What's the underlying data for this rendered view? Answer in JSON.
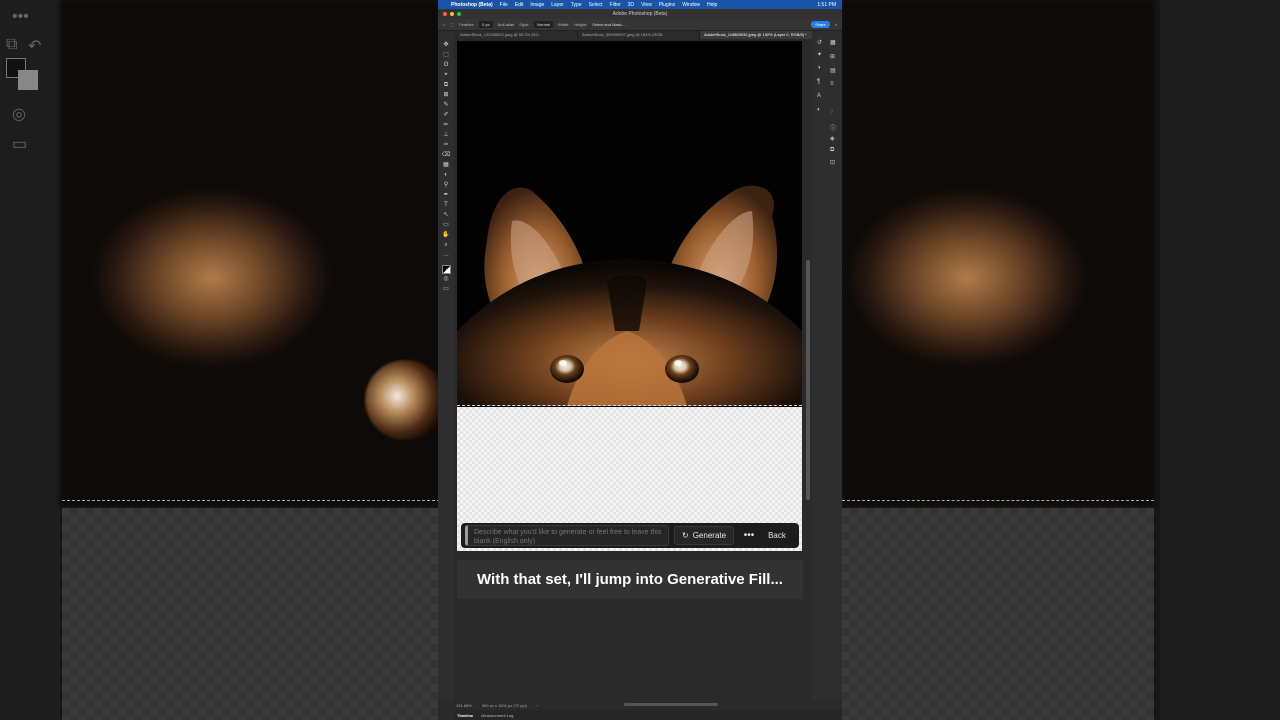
{
  "menubar": {
    "app_name": "Photoshop (Beta)",
    "items": [
      "File",
      "Edit",
      "Image",
      "Layer",
      "Type",
      "Select",
      "Filter",
      "3D",
      "View",
      "Plugins",
      "Window",
      "Help"
    ],
    "clock": "1:51 PM"
  },
  "window": {
    "title": "Adobe Photoshop (Beta)"
  },
  "options_bar": {
    "feather_label": "Feather:",
    "feather_value": "0 px",
    "anti_alias_label": "Anti-alias",
    "style_label": "Style:",
    "style_value": "Normal",
    "width_label": "Width:",
    "height_label": "Height:",
    "select_mask_label": "Select and Mask...",
    "share_label": "Share"
  },
  "document_tabs": [
    {
      "label": "AdobeStock_122035922.jpeg @ 55.2% (RG..."
    },
    {
      "label": "AdobeStock_599559497.jpeg @ 184% (RGB..."
    },
    {
      "label": "AdobeStock_116869932.jpeg @ 192% (Layer 0, RGB/8) *"
    }
  ],
  "tools": [
    "✥",
    "⬚",
    "ʘ",
    "⌖",
    "⧉",
    "⊠",
    "✎",
    "✐",
    "✏",
    "⊥",
    "✑",
    "⌫",
    "▦",
    "◐",
    "⚲",
    "✒",
    "T",
    "↖",
    "▭",
    "✋",
    "⌕",
    "…"
  ],
  "task_bar": {
    "prompt_placeholder": "Describe what you'd like to generate or feel free to leave this blank (English only).",
    "generate_label": "Generate",
    "more_label": "•••",
    "back_label": "Back"
  },
  "caption": {
    "text": "With that set, I'll jump into Generative Fill..."
  },
  "status_bar": {
    "zoom": "191.88%",
    "dimensions": "900 px x 1601 px (72 ppi)"
  },
  "bottom_panel": {
    "tabs": [
      "Timeline",
      "Measurement Log"
    ]
  },
  "colors": {
    "menubar": "#1a54a8",
    "share_button": "#2680eb",
    "canvas_bg": "#020202",
    "caption_bg": "#323232"
  }
}
